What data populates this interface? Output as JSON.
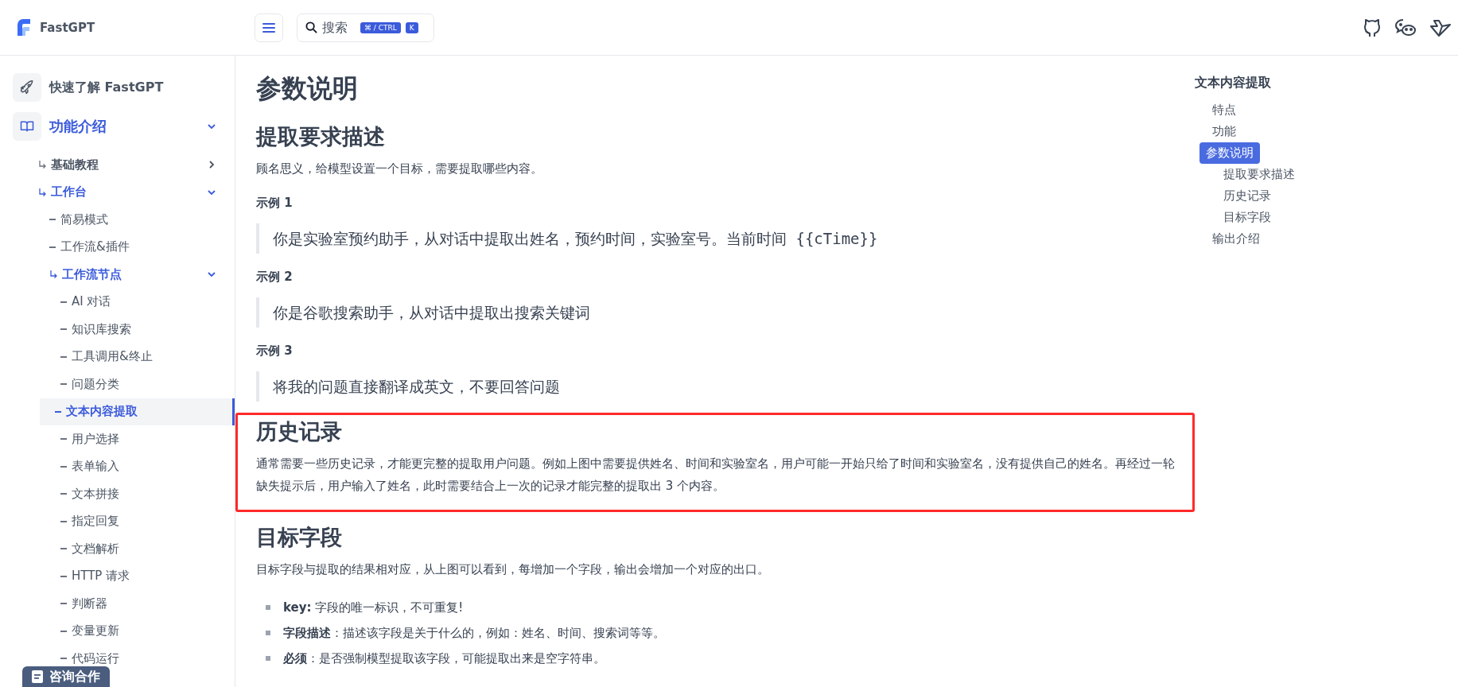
{
  "header": {
    "brand": "FastGPT",
    "search": {
      "placeholder": "搜索",
      "shortcut": "⌘ / CTRL",
      "key": "K"
    }
  },
  "sidebar": {
    "items": [
      {
        "label": "快速了解 FastGPT",
        "selected": false
      },
      {
        "label": "功能介绍",
        "selected": false,
        "expanded": true,
        "children": [
          {
            "label": "基础教程",
            "selected": false,
            "expanded": false
          },
          {
            "label": "工作台",
            "selected": false,
            "expanded": true,
            "children": [
              {
                "label": "简易模式",
                "selected": false
              },
              {
                "label": "工作流&插件",
                "selected": false
              },
              {
                "label": "工作流节点",
                "selected": false,
                "expanded": true,
                "children": [
                  {
                    "label": "AI 对话",
                    "selected": false
                  },
                  {
                    "label": "知识库搜索",
                    "selected": false
                  },
                  {
                    "label": "工具调用&终止",
                    "selected": false
                  },
                  {
                    "label": "问题分类",
                    "selected": false
                  },
                  {
                    "label": "文本内容提取",
                    "selected": true
                  },
                  {
                    "label": "用户选择",
                    "selected": false
                  },
                  {
                    "label": "表单输入",
                    "selected": false
                  },
                  {
                    "label": "文本拼接",
                    "selected": false
                  },
                  {
                    "label": "指定回复",
                    "selected": false
                  },
                  {
                    "label": "文档解析",
                    "selected": false
                  },
                  {
                    "label": "HTTP 请求",
                    "selected": false
                  },
                  {
                    "label": "判断器",
                    "selected": false
                  },
                  {
                    "label": "变量更新",
                    "selected": false
                  },
                  {
                    "label": "代码运行",
                    "selected": false
                  }
                ]
              }
            ]
          }
        ]
      }
    ],
    "contact_button": "咨询合作"
  },
  "content": {
    "title": "参数说明",
    "sections": [
      {
        "heading": "提取要求描述",
        "highlighted": false,
        "blocks": [
          {
            "kind": "paragraph",
            "text": "顾名思义，给模型设置一个目标，需要提取哪些内容。"
          },
          {
            "kind": "label",
            "text": "示例 1"
          },
          {
            "kind": "quote",
            "text": "你是实验室预约助手，从对话中提取出姓名，预约时间，实验室号。当前时间 {{cTime}}"
          },
          {
            "kind": "label",
            "text": "示例 2"
          },
          {
            "kind": "quote",
            "text": "你是谷歌搜索助手，从对话中提取出搜索关键词"
          },
          {
            "kind": "label",
            "text": "示例 3"
          },
          {
            "kind": "quote",
            "text": "将我的问题直接翻译成英文，不要回答问题"
          }
        ]
      },
      {
        "heading": "历史记录",
        "highlighted": true,
        "blocks": [
          {
            "kind": "paragraph",
            "text": "通常需要一些历史记录，才能更完整的提取用户问题。例如上图中需要提供姓名、时间和实验室名，用户可能一开始只给了时间和实验室名，没有提供自己的姓名。再经过一轮缺失提示后，用户输入了姓名，此时需要结合上一次的记录才能完整的提取出 3 个内容。"
          }
        ]
      },
      {
        "heading": "目标字段",
        "highlighted": false,
        "blocks": [
          {
            "kind": "paragraph",
            "text": "目标字段与提取的结果相对应，从上图可以看到，每增加一个字段，输出会增加一个对应的出口。"
          },
          {
            "kind": "bullets",
            "items": [
              "**key:** 字段的唯一标识，不可重复!",
              "**字段描述**：描述该字段是关于什么的，例如：姓名、时间、搜索词等等。",
              "**必须**：是否强制模型提取该字段，可能提取出来是空字符串。"
            ]
          }
        ]
      }
    ]
  },
  "toc": {
    "title": "文本内容提取",
    "items": [
      {
        "label": "特点",
        "selected": false
      },
      {
        "label": "功能",
        "selected": false
      },
      {
        "label": "参数说明",
        "selected": true,
        "children": [
          {
            "label": "提取要求描述",
            "selected": false
          },
          {
            "label": "历史记录",
            "selected": false
          },
          {
            "label": "目标字段",
            "selected": false
          }
        ]
      },
      {
        "label": "输出介绍",
        "selected": false
      }
    ]
  }
}
